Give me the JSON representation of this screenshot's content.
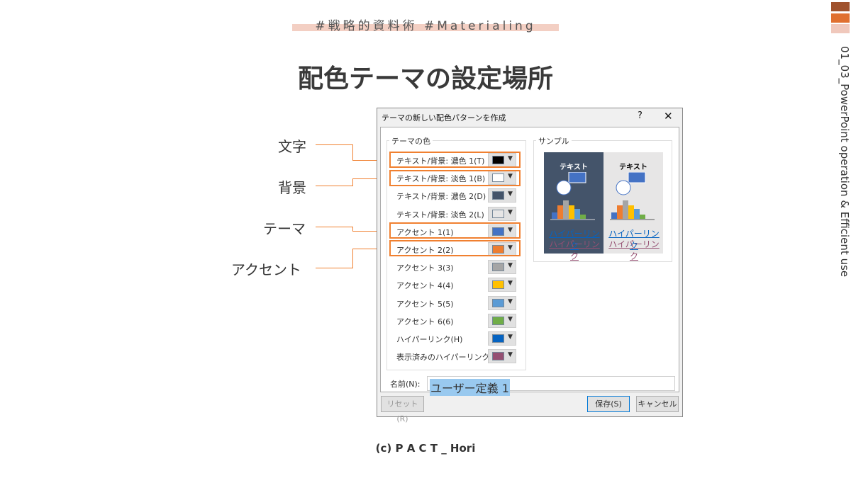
{
  "header": {
    "tagline": "#戦略的資料術 #Materialing",
    "title": "配色テーマの設定場所",
    "side_label": "01_03_PowerPoint operation & Efficient use",
    "brand_colors": [
      "#a0522d",
      "#e07030",
      "#f0c8bc"
    ]
  },
  "callouts": [
    {
      "label": "文字"
    },
    {
      "label": "背景"
    },
    {
      "label": "テーマ"
    },
    {
      "label": "アクセント"
    }
  ],
  "dialog": {
    "title": "テーマの新しい配色パターンを作成",
    "help": "?",
    "close": "✕",
    "theme_group": "テーマの色",
    "sample_group": "サンプル",
    "rows": [
      {
        "label": "テキスト/背景: 濃色 1(T)",
        "color": "#000000"
      },
      {
        "label": "テキスト/背景: 淡色 1(B)",
        "color": "#ffffff"
      },
      {
        "label": "テキスト/背景: 濃色 2(D)",
        "color": "#44546a"
      },
      {
        "label": "テキスト/背景: 淡色 2(L)",
        "color": "#e7e6e6"
      },
      {
        "label": "アクセント 1(1)",
        "color": "#4472c4"
      },
      {
        "label": "アクセント 2(2)",
        "color": "#ed7d31"
      },
      {
        "label": "アクセント 3(3)",
        "color": "#a5a5a5"
      },
      {
        "label": "アクセント 4(4)",
        "color": "#ffc000"
      },
      {
        "label": "アクセント 5(5)",
        "color": "#5b9bd5"
      },
      {
        "label": "アクセント 6(6)",
        "color": "#70ad47"
      },
      {
        "label": "ハイパーリンク(H)",
        "color": "#0563c1"
      },
      {
        "label": "表示済みのハイパーリンク(F)",
        "color": "#954f72"
      }
    ],
    "sample": {
      "text": "テキスト",
      "hyperlink": "ハイパーリンク",
      "visited": "ハイパーリンク"
    },
    "name_label": "名前(N):",
    "name_value": "ユーザー定義 1",
    "reset": "リセット(R)",
    "save": "保存(S)",
    "cancel": "キャンセル"
  },
  "footer": "(c) P A C T _ Hori"
}
